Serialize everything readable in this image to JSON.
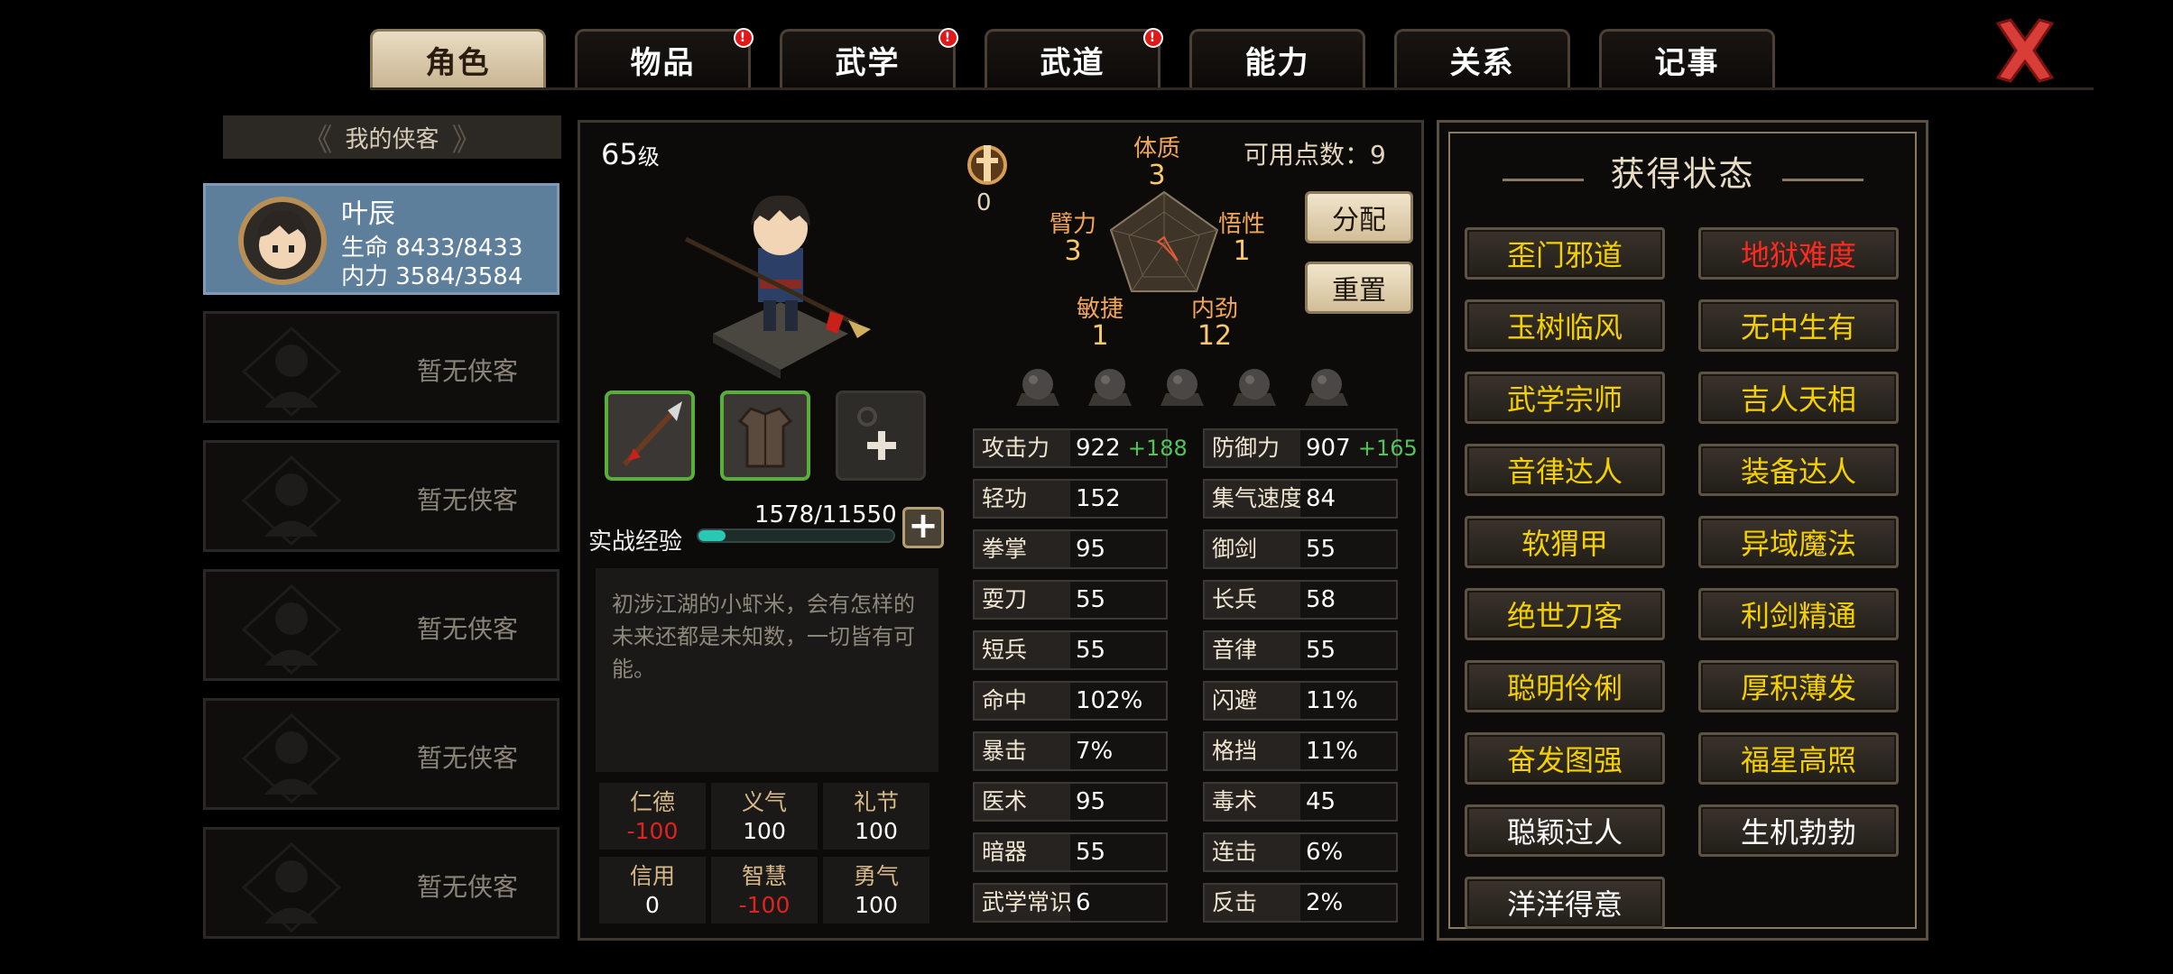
{
  "tabs": [
    {
      "label": "角色",
      "active": true,
      "badge": false
    },
    {
      "label": "物品",
      "active": false,
      "badge": true
    },
    {
      "label": "武学",
      "active": false,
      "badge": true
    },
    {
      "label": "武道",
      "active": false,
      "badge": true
    },
    {
      "label": "能力",
      "active": false,
      "badge": false
    },
    {
      "label": "关系",
      "active": false,
      "badge": false
    },
    {
      "label": "记事",
      "active": false,
      "badge": false
    }
  ],
  "badge_mark": "!",
  "list": {
    "header": "我的侠客",
    "selected": {
      "name": "叶辰",
      "hp": "生命 8433/8433",
      "mp": "内力 3584/3584"
    },
    "empty_label": "暂无侠客"
  },
  "character": {
    "level_num": "65",
    "level_unit": "级",
    "rank_count": "0",
    "exp": {
      "label": "实战经验",
      "value": "1578/11550",
      "progress": 0.137
    },
    "description": "初涉江湖的小虾米，会有怎样的未来还都是未知数，一切皆有可能。",
    "virtues": [
      {
        "k": "仁德",
        "v": "-100",
        "neg": true
      },
      {
        "k": "义气",
        "v": "100",
        "neg": false
      },
      {
        "k": "礼节",
        "v": "100",
        "neg": false
      },
      {
        "k": "信用",
        "v": "0",
        "neg": false
      },
      {
        "k": "智慧",
        "v": "-100",
        "neg": true
      },
      {
        "k": "勇气",
        "v": "100",
        "neg": false
      }
    ]
  },
  "attributes": {
    "available_label": "可用点数：9",
    "items": [
      {
        "k": "体质",
        "v": "3"
      },
      {
        "k": "悟性",
        "v": "1"
      },
      {
        "k": "内劲",
        "v": "12"
      },
      {
        "k": "敏捷",
        "v": "1"
      },
      {
        "k": "臂力",
        "v": "3"
      }
    ],
    "allocate_label": "分配",
    "reset_label": "重置"
  },
  "stats": {
    "left": [
      {
        "k": "攻击力",
        "v": "922",
        "bonus": "+188"
      },
      {
        "k": "轻功",
        "v": "152",
        "bonus": ""
      },
      {
        "k": "拳掌",
        "v": "95",
        "bonus": ""
      },
      {
        "k": "耍刀",
        "v": "55",
        "bonus": ""
      },
      {
        "k": "短兵",
        "v": "55",
        "bonus": ""
      },
      {
        "k": "命中",
        "v": "102%",
        "bonus": ""
      },
      {
        "k": "暴击",
        "v": "7%",
        "bonus": ""
      },
      {
        "k": "医术",
        "v": "95",
        "bonus": ""
      },
      {
        "k": "暗器",
        "v": "55",
        "bonus": ""
      },
      {
        "k": "武学常识",
        "v": "6",
        "bonus": ""
      }
    ],
    "right": [
      {
        "k": "防御力",
        "v": "907",
        "bonus": "+165"
      },
      {
        "k": "集气速度",
        "v": "84",
        "bonus": ""
      },
      {
        "k": "御剑",
        "v": "55",
        "bonus": ""
      },
      {
        "k": "长兵",
        "v": "58",
        "bonus": ""
      },
      {
        "k": "音律",
        "v": "55",
        "bonus": ""
      },
      {
        "k": "闪避",
        "v": "11%",
        "bonus": ""
      },
      {
        "k": "格挡",
        "v": "11%",
        "bonus": ""
      },
      {
        "k": "毒术",
        "v": "45",
        "bonus": ""
      },
      {
        "k": "连击",
        "v": "6%",
        "bonus": ""
      },
      {
        "k": "反击",
        "v": "2%",
        "bonus": ""
      }
    ]
  },
  "status": {
    "title": "获得状态",
    "items": [
      {
        "label": "歪门邪道",
        "color": "#f5d000"
      },
      {
        "label": "地狱难度",
        "color": "#ff2a1f"
      },
      {
        "label": "玉树临风",
        "color": "#f5d000"
      },
      {
        "label": "无中生有",
        "color": "#f5d000"
      },
      {
        "label": "武学宗师",
        "color": "#f5d000"
      },
      {
        "label": "吉人天相",
        "color": "#f5d000"
      },
      {
        "label": "音律达人",
        "color": "#f5d000"
      },
      {
        "label": "装备达人",
        "color": "#f5d000"
      },
      {
        "label": "软猬甲",
        "color": "#f5d000"
      },
      {
        "label": "异域魔法",
        "color": "#f5d000"
      },
      {
        "label": "绝世刀客",
        "color": "#f5d000"
      },
      {
        "label": "利剑精通",
        "color": "#f5d000"
      },
      {
        "label": "聪明伶俐",
        "color": "#f5d000"
      },
      {
        "label": "厚积薄发",
        "color": "#f5d000"
      },
      {
        "label": "奋发图强",
        "color": "#f5d000"
      },
      {
        "label": "福星高照",
        "color": "#f5d000"
      },
      {
        "label": "聪颖过人",
        "color": "#ffffff"
      },
      {
        "label": "生机勃勃",
        "color": "#ffffff"
      },
      {
        "label": "洋洋得意",
        "color": "#ffffff"
      }
    ]
  },
  "icons": [
    "close-icon",
    "rank-icon",
    "spear-icon",
    "robe-icon",
    "add-slot-icon",
    "exp-plus-icon",
    "meridian-orb-icon"
  ]
}
